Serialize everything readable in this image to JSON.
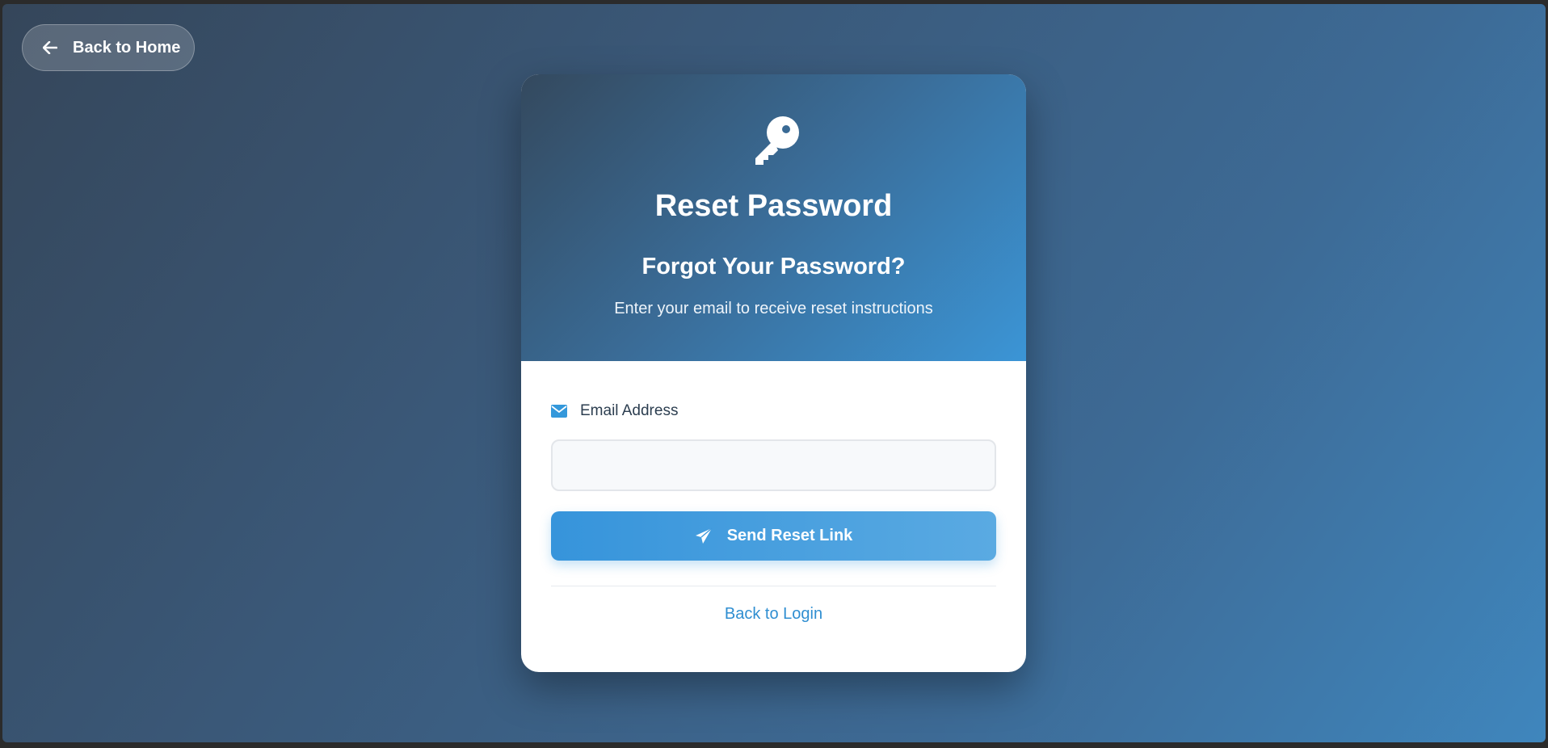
{
  "nav": {
    "back_home_label": "Back to Home"
  },
  "header": {
    "title": "Reset Password",
    "subtitle": "Forgot Your Password?",
    "description": "Enter your email to receive reset instructions"
  },
  "form": {
    "email_label": "Email Address",
    "email_value": "",
    "email_placeholder": "",
    "submit_label": "Send Reset Link",
    "back_login_label": "Back to Login"
  },
  "icons": {
    "back": "arrow-left-icon",
    "header": "key-icon",
    "email": "envelope-icon",
    "submit": "paper-plane-icon"
  },
  "colors": {
    "accent": "#3498db",
    "link": "#2f8ed1",
    "text_dark": "#2c3e50"
  }
}
